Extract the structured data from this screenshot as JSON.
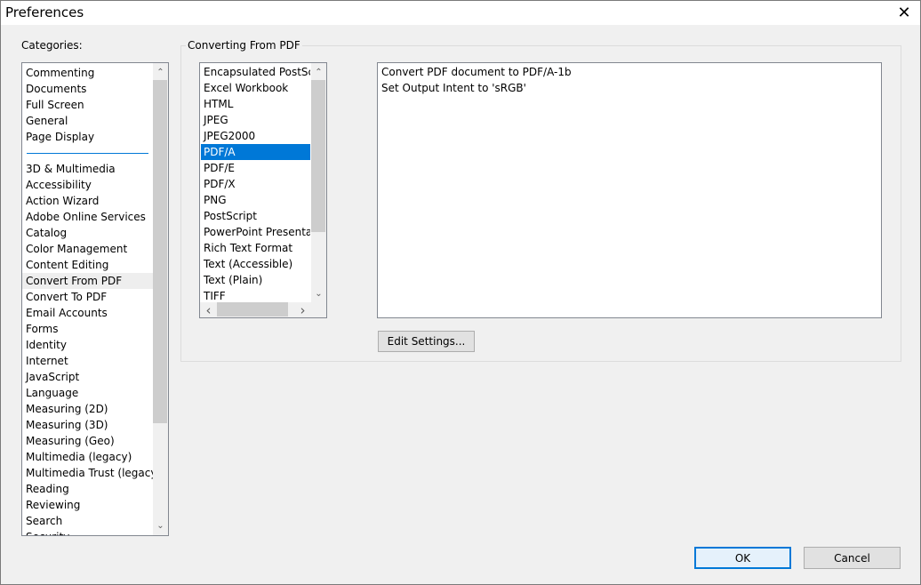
{
  "window": {
    "title": "Preferences",
    "close_glyph": "✕"
  },
  "categories": {
    "label": "Categories:",
    "top_items": [
      {
        "label": "Commenting"
      },
      {
        "label": "Documents"
      },
      {
        "label": "Full Screen"
      },
      {
        "label": "General"
      },
      {
        "label": "Page Display"
      }
    ],
    "items": [
      {
        "label": "3D & Multimedia"
      },
      {
        "label": "Accessibility"
      },
      {
        "label": "Action Wizard"
      },
      {
        "label": "Adobe Online Services"
      },
      {
        "label": "Catalog"
      },
      {
        "label": "Color Management"
      },
      {
        "label": "Content Editing"
      },
      {
        "label": "Convert From PDF"
      },
      {
        "label": "Convert To PDF"
      },
      {
        "label": "Email Accounts"
      },
      {
        "label": "Forms"
      },
      {
        "label": "Identity"
      },
      {
        "label": "Internet"
      },
      {
        "label": "JavaScript"
      },
      {
        "label": "Language"
      },
      {
        "label": "Measuring (2D)"
      },
      {
        "label": "Measuring (3D)"
      },
      {
        "label": "Measuring (Geo)"
      },
      {
        "label": "Multimedia (legacy)"
      },
      {
        "label": "Multimedia Trust (legacy)"
      },
      {
        "label": "Reading"
      },
      {
        "label": "Reviewing"
      },
      {
        "label": "Search"
      },
      {
        "label": "Security"
      }
    ],
    "current": "Convert From PDF"
  },
  "converting": {
    "legend": "Converting From PDF",
    "formats": [
      {
        "label": "Encapsulated PostScript"
      },
      {
        "label": "Excel Workbook"
      },
      {
        "label": "HTML"
      },
      {
        "label": "JPEG"
      },
      {
        "label": "JPEG2000"
      },
      {
        "label": "PDF/A"
      },
      {
        "label": "PDF/E"
      },
      {
        "label": "PDF/X"
      },
      {
        "label": "PNG"
      },
      {
        "label": "PostScript"
      },
      {
        "label": "PowerPoint Presentation"
      },
      {
        "label": "Rich Text Format"
      },
      {
        "label": "Text (Accessible)"
      },
      {
        "label": "Text (Plain)"
      },
      {
        "label": "TIFF"
      }
    ],
    "selected_format": "PDF/A",
    "settings": [
      {
        "text": "Convert PDF document to PDF/A-1b"
      },
      {
        "text": "Set Output Intent to 'sRGB'"
      }
    ],
    "edit_settings_label": "Edit Settings..."
  },
  "footer": {
    "ok_label": "OK",
    "cancel_label": "Cancel"
  },
  "icons": {
    "up": "⌃",
    "down": "⌄",
    "left": "‹",
    "right": "›"
  }
}
